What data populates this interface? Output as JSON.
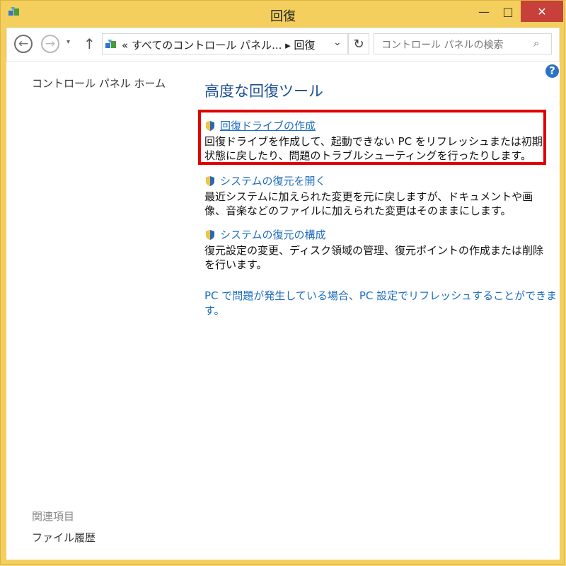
{
  "window": {
    "title": "回復"
  },
  "titlebar": {
    "minimize": "—",
    "maximize": "□",
    "close": "✕"
  },
  "navbar": {
    "back": "←",
    "forward": "→",
    "history": "▾",
    "up": "↑",
    "address": "« すべてのコントロール パネル... ▸ 回復",
    "dropdown": "⌄",
    "refresh": "↻",
    "search_placeholder": "コントロール パネルの検索",
    "search_icon": "⌕"
  },
  "left_nav": {
    "home": "コントロール パネル ホーム"
  },
  "related": {
    "title": "関連項目",
    "link": "ファイル履歴"
  },
  "help": "?",
  "main": {
    "heading": "高度な回復ツール",
    "items": [
      {
        "link": "回復ドライブの作成",
        "description": "回復ドライブを作成して、起動できない PC をリフレッシュまたは初期状態に戻したり、問題のトラブルシューティングを行ったりします。"
      },
      {
        "link": "システムの復元を開く",
        "description": "最近システムに加えられた変更を元に戻しますが、ドキュメントや画像、音楽などのファイルに加えられた変更はそのままにします。"
      },
      {
        "link": "システムの復元の構成",
        "description": "復元設定の変更、ディスク領域の管理、復元ポイントの作成または削除を行います。"
      }
    ],
    "pc_settings_link": "PC で問題が発生している場合、PC 設定でリフレッシュすることができます。"
  },
  "colors": {
    "window_border": "#f4cf5d",
    "link": "#1f6dc0",
    "heading": "#1d4f91",
    "highlight": "#e00000",
    "close": "#c7403a"
  }
}
